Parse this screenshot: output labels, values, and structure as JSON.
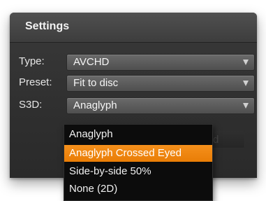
{
  "settings": {
    "title": "Settings",
    "type": {
      "label": "Type:",
      "value": "AVCHD"
    },
    "preset": {
      "label": "Preset:",
      "value": "Fit to disc"
    },
    "s3d": {
      "label": "S3D:",
      "value": "Anaglyph"
    },
    "advanced_label": "Advanced",
    "s3d_options": [
      "Anaglyph",
      "Anaglyph Crossed Eyed",
      "Side-by-side 50%",
      "None (2D)"
    ],
    "highlighted_option": "Anaglyph Crossed Eyed"
  },
  "colors": {
    "panel_bg": "#2f2f2f",
    "accent_highlight": "#f0870e",
    "dropdown_bg": "#0c0c0c"
  }
}
